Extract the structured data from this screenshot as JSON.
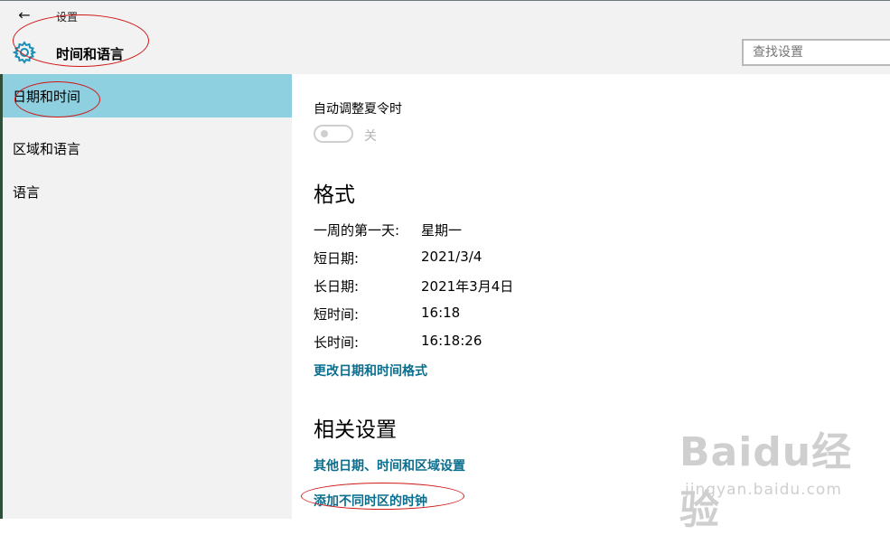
{
  "window": {
    "app_name": "设置",
    "back_icon": "back-arrow-icon",
    "gear_icon": "gear-icon",
    "section_title": "时间和语言"
  },
  "search": {
    "placeholder": "查找设置"
  },
  "sidebar": {
    "items": [
      {
        "label": "日期和时间",
        "selected": true
      },
      {
        "label": "区域和语言",
        "selected": false
      },
      {
        "label": "语言",
        "selected": false
      }
    ]
  },
  "main": {
    "dst": {
      "label": "自动调整夏令时",
      "toggle_state": "关",
      "enabled": false
    },
    "format": {
      "heading": "格式",
      "rows": [
        {
          "label": "一周的第一天:",
          "value": "星期一"
        },
        {
          "label": "短日期:",
          "value": "2021/3/4"
        },
        {
          "label": "长日期:",
          "value": "2021年3月4日"
        },
        {
          "label": "短时间:",
          "value": "16:18"
        },
        {
          "label": "长时间:",
          "value": "16:18:26"
        }
      ],
      "change_link": "更改日期和时间格式"
    },
    "related": {
      "heading": "相关设置",
      "links": [
        "其他日期、时间和区域设置",
        "添加不同时区的时钟"
      ]
    }
  },
  "watermark": {
    "brand": "Baidu经验",
    "url": "jingyan.baidu.com"
  },
  "colors": {
    "accent": "#0a6e8f",
    "selected_nav": "#8ecfe0",
    "annotation": "#d01818"
  }
}
